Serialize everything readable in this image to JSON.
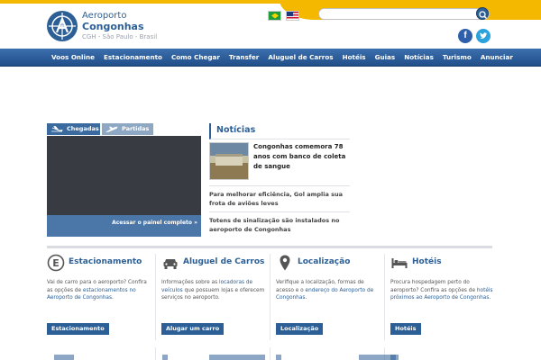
{
  "header": {
    "logo_line1": "Aeroporto",
    "logo_line2": "Congonhas",
    "logo_line3": "CGH - São Paulo - Brasil",
    "search_placeholder": "",
    "accent_yellow": "#f5b800",
    "accent_blue": "#2b5f96"
  },
  "languages": [
    {
      "name": "brazil-flag-icon"
    },
    {
      "name": "usa-flag-icon"
    }
  ],
  "social": {
    "facebook": "f",
    "twitter": "t"
  },
  "nav": {
    "items": [
      "Voos Online",
      "Estacionamento",
      "Como Chegar",
      "Transfer",
      "Aluguel de Carros",
      "Hotéis",
      "Guias",
      "Notícias",
      "Turismo",
      "Anunciar"
    ]
  },
  "flights": {
    "tabs": [
      "Chegadas",
      "Partidas"
    ],
    "panel_link": "Acessar o painel completo »"
  },
  "news": {
    "title": "Notícias",
    "items": [
      "Congonhas comemora 78 anos com banco de coleta de sangue",
      "Para melhorar eficiência, Gol amplia sua frota de aviões leves",
      "Totens de sinalização são instalados no aeroporto de Congonhas"
    ]
  },
  "cards": [
    {
      "icon": "parking-icon",
      "title": "Estacionamento",
      "text_before": "Vai de carro para o aeroporto? Confira as opções de ",
      "text_link": "estacionamentos no Aeroporto de Congonhas",
      "text_after": ".",
      "button": "Estacionamento"
    },
    {
      "icon": "car-icon",
      "title": "Aluguel de Carros",
      "text_before": "Informações sobre as ",
      "text_link": "locadoras de veículos",
      "text_after": " que possuem lojas e oferecem serviços no aeroporto.",
      "button": "Alugar um carro"
    },
    {
      "icon": "location-pin-icon",
      "title": "Localização",
      "text_before": "Verifique a localização, formas de acesso e o ",
      "text_link": "endereço do Aeroporto de Congonhas",
      "text_after": ".",
      "button": "Localização"
    },
    {
      "icon": "bed-icon",
      "title": "Hotéis",
      "text_before": "Procura hospedagem perto do aeroporto? Confira as opções de ",
      "text_link": "hotéis próximos ao Aeroporto de Congonhas",
      "text_after": ".",
      "button": "Hotéis"
    }
  ]
}
